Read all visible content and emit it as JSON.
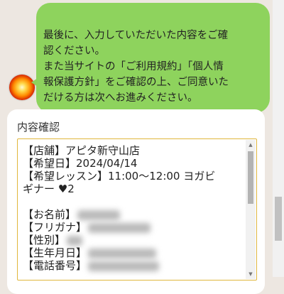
{
  "bot": {
    "avatar_icon": "flame-orb-icon",
    "message": "最後に、入力していただいた内容をご確\n認ください。\nまた当サイトの「ご利用規約」「個人情\n報保護方針」をご確認の上、ご同意いた\nだける方は次へお進みください。"
  },
  "confirm": {
    "title": "内容確認",
    "lines": {
      "store": "【店舗】アピタ新守山店",
      "date": "【希望日】2024/04/14",
      "lesson_1": "【希望レッスン】11:00～12:00 ヨガビ",
      "lesson_2": "ギナー ♥2",
      "name_label": "【お名前】",
      "kana_label": "【フリガナ】",
      "gender_label": "【性別】",
      "birth_label": "【生年月日】",
      "phone_label": "【電話番号】"
    }
  },
  "colors": {
    "bubble": "#8ed35d",
    "textbox_border": "#e0b63c",
    "background": "#ede7e1"
  }
}
